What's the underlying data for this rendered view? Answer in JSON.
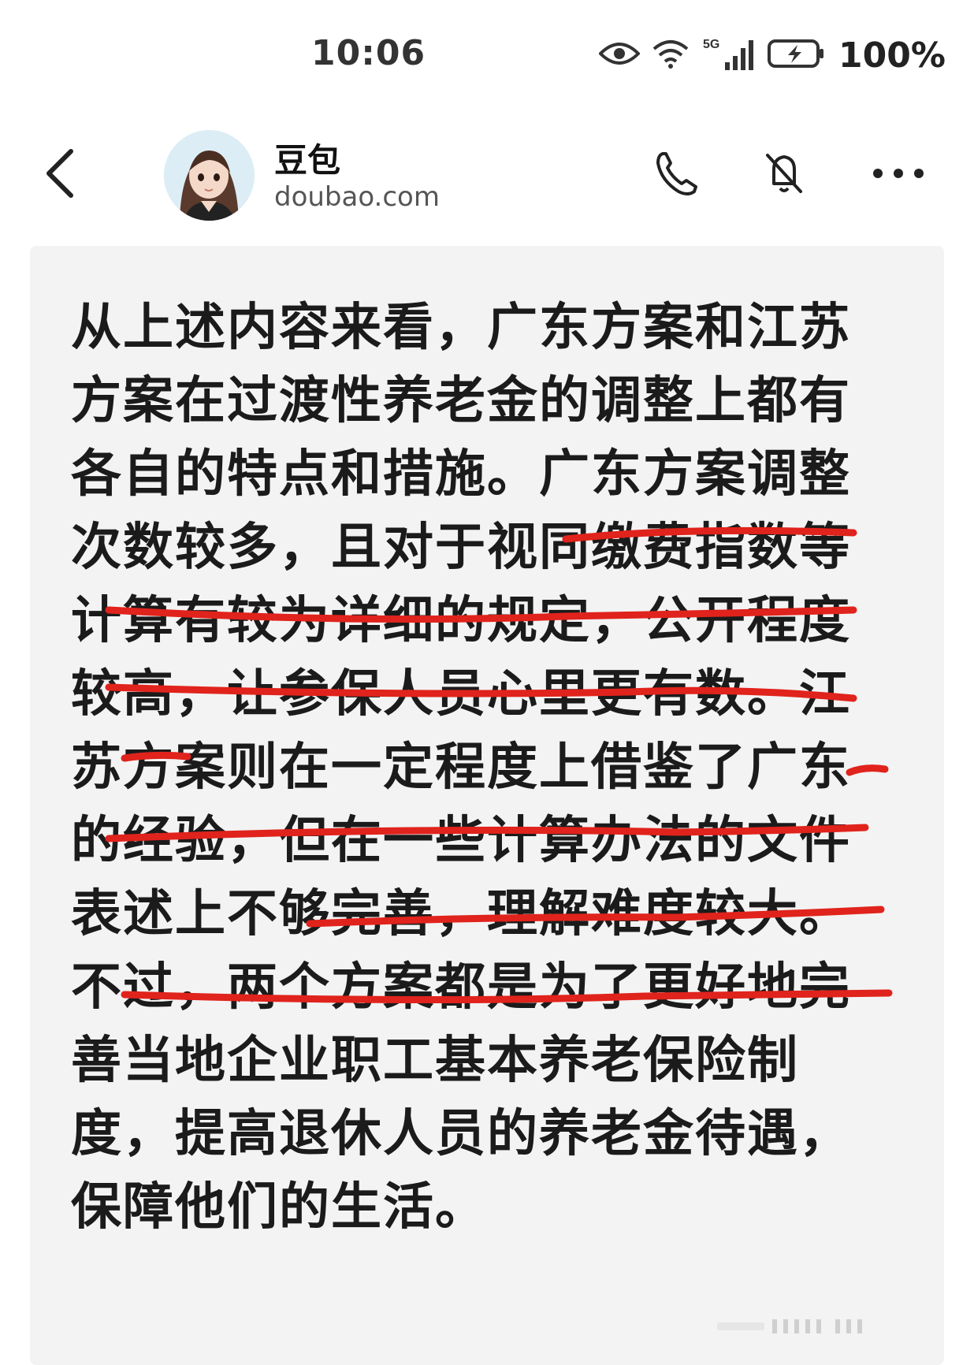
{
  "status_bar": {
    "time": "10:06",
    "network": "5G",
    "battery": "100%",
    "icons": [
      "eye-icon",
      "wifi-icon",
      "signal-5g-icon",
      "battery-charging-icon"
    ]
  },
  "header": {
    "contact_name": "豆包",
    "contact_subtitle": "doubao.com",
    "icons": [
      "back-chevron-icon",
      "avatar",
      "phone-icon",
      "mute-icon",
      "more-icon"
    ]
  },
  "message": {
    "lines": [
      "从上述内容来看，广东方案和江苏",
      "方案在过渡性养老金的调整上都有",
      "各自的特点和措施。广东方案调整",
      "次数较多，且对于视同缴费指数等",
      "计算有较为详细的规定，公开程度",
      "较高，让参保人员心里更有数。江",
      "苏方案则在一定程度上借鉴了广东",
      "的经验，但在一些计算办法的文件",
      "表述上不够完善，理解难度较大。",
      "不过，两个方案都是为了更好地完",
      "善当地企业职工基本养老保险制",
      "度，提高退休人员的养老金待遇，",
      "保障他们的生活。"
    ],
    "underline_color": "#e0231c"
  }
}
